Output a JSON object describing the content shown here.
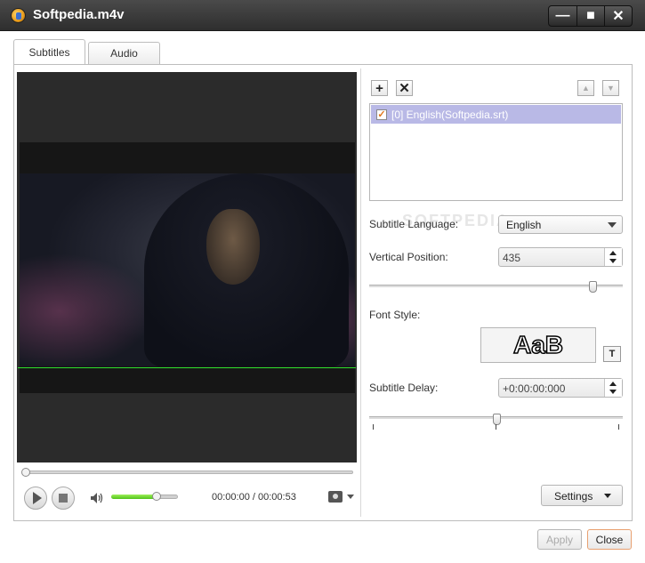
{
  "window": {
    "title": "Softpedia.m4v",
    "minimize": "—",
    "maximize": "■",
    "close": "✕"
  },
  "tabs": [
    {
      "label": "Subtitles",
      "active": true
    },
    {
      "label": "Audio",
      "active": false
    }
  ],
  "player": {
    "time": "00:00:00 / 00:00:53",
    "volume_percent": 68,
    "seek_percent": 0
  },
  "subtitles": {
    "add": "+",
    "remove": "✕",
    "move_up": "▲",
    "move_down": "▼",
    "items": [
      {
        "text": "[0] English(Softpedia.srt)",
        "checked": true
      }
    ]
  },
  "settings_panel": {
    "language_label": "Subtitle Language:",
    "language_value": "English",
    "vertical_label": "Vertical Position:",
    "vertical_value": "435",
    "vertical_slider_percent": 88,
    "font_label": "Font Style:",
    "font_preview": "AaB",
    "font_button": "T",
    "delay_label": "Subtitle Delay:",
    "delay_value": "+0:00:00:000",
    "delay_slider_percent": 50,
    "watermark": "SOFTPEDIA"
  },
  "buttons": {
    "settings": "Settings",
    "apply": "Apply",
    "close": "Close"
  },
  "colors": {
    "titlebar": "#2e2e2e",
    "selection": "#b9b9e6",
    "volume_fill": "#4fc21a",
    "close_border": "#e8a070"
  }
}
